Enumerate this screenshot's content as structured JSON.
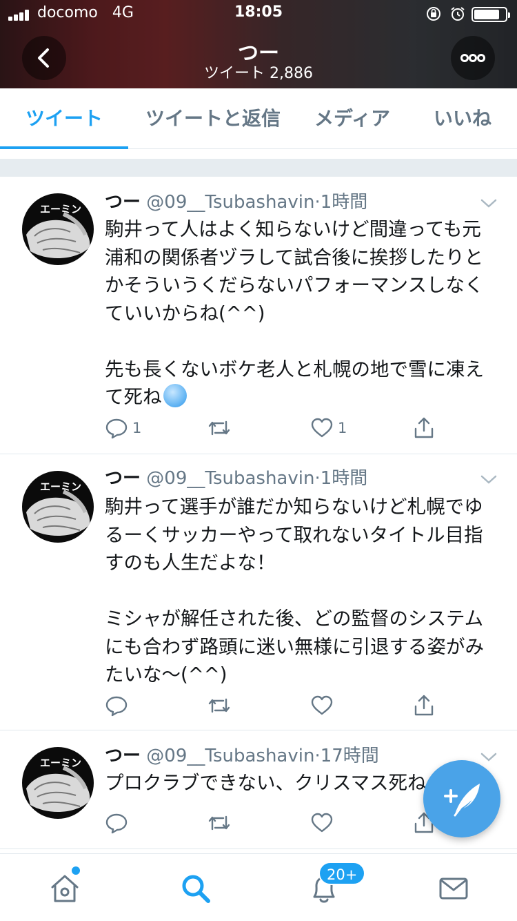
{
  "status_bar": {
    "carrier": "docomo",
    "network": "4G",
    "time": "18:05"
  },
  "nav": {
    "title": "つー",
    "subtitle": "ツイート 2,886"
  },
  "tabs": [
    {
      "label": "ツイート",
      "active": true
    },
    {
      "label": "ツイートと返信",
      "active": false
    },
    {
      "label": "メディア",
      "active": false
    },
    {
      "label": "いいね",
      "active": false
    }
  ],
  "tweets": [
    {
      "avatar_label": "エーミン",
      "name": "つー",
      "handle": "@09__Tsubashavin",
      "separator": "·",
      "time": "1時間",
      "text": "駒井って人はよく知らないけど間違っても元浦和の関係者ヅラして試合後に挨拶したりとかそういうくだらないパフォーマンスしなくていいからね(^^)\n\n先も長くないボケ老人と札幌の地で雪に凍えて死ね",
      "emoji": "freezing-face-emoji",
      "replies": "1",
      "retweets": "",
      "likes": "1"
    },
    {
      "avatar_label": "エーミン",
      "name": "つー",
      "handle": "@09__Tsubashavin",
      "separator": "·",
      "time": "1時間",
      "text": "駒井って選手が誰だか知らないけど札幌でゆるーくサッカーやって取れないタイトル目指すのも人生だよな！\n\nミシャが解任された後、どの監督のシステムにも合わず路頭に迷い無様に引退する姿がみたいな〜(^^)",
      "replies": "",
      "retweets": "",
      "likes": ""
    },
    {
      "avatar_label": "エーミン",
      "name": "つー",
      "handle": "@09__Tsubashavin",
      "separator": "·",
      "time": "17時間",
      "text": "プロクラブできない、クリスマス死ね",
      "replies": "",
      "retweets": "",
      "likes": ""
    }
  ],
  "bottom_bar": {
    "notifications_badge": "20+"
  },
  "colors": {
    "accent": "#1da1f2",
    "fab": "#4aa3e8",
    "muted": "#657786"
  }
}
